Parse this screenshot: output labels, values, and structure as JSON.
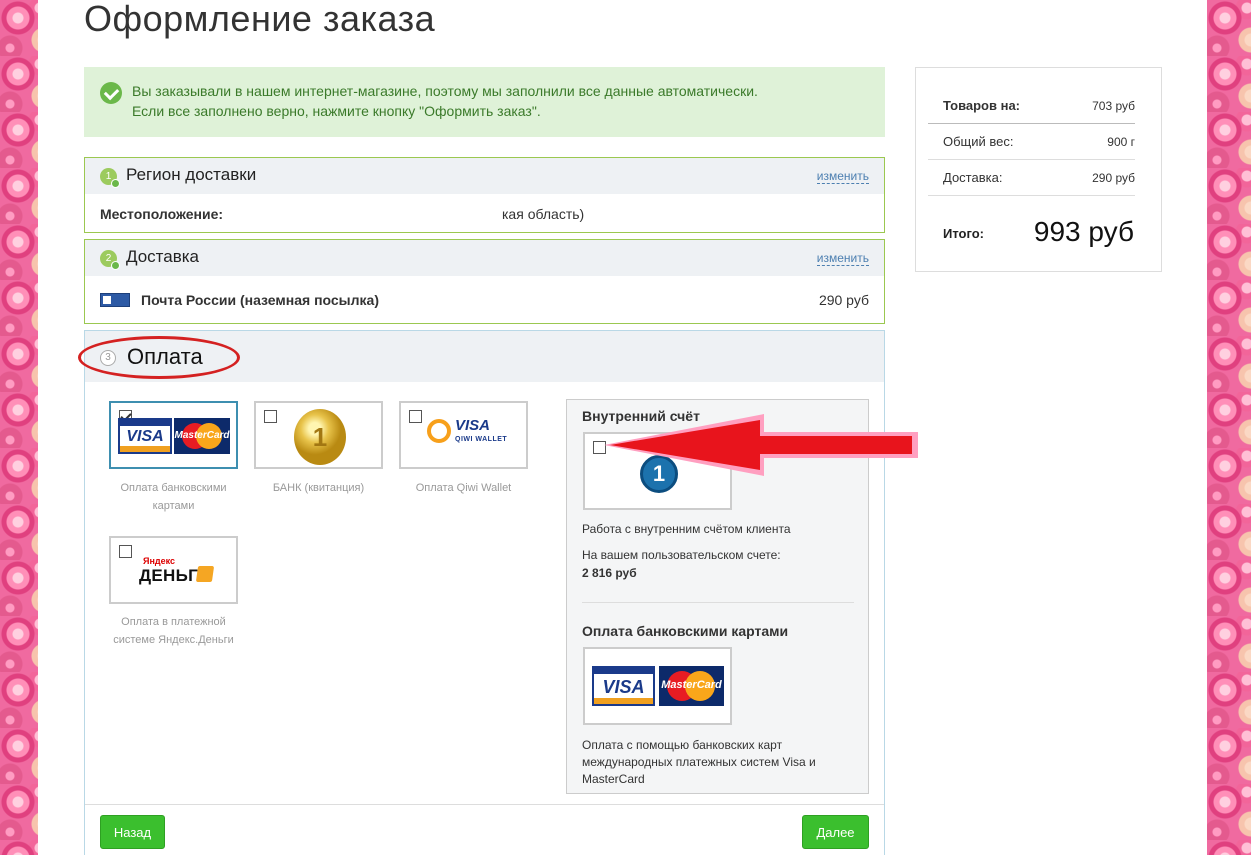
{
  "page": {
    "title": "Оформление заказа"
  },
  "notice": {
    "line1": "Вы заказывали в нашем интернет-магазине, поэтому мы заполнили все данные автоматически.",
    "line2": "Если все заполнено верно, нажмите кнопку \"Оформить заказ\"."
  },
  "region": {
    "step": "1",
    "title": "Регион доставки",
    "change": "изменить",
    "location_label": "Местоположение:",
    "location_value": "кая область)"
  },
  "delivery": {
    "step": "2",
    "title": "Доставка",
    "change": "изменить",
    "method": "Почта России (наземная посылка)",
    "price": "290 руб"
  },
  "payment": {
    "step": "3",
    "title": "Оплата",
    "options": [
      {
        "label": "Оплата банковскими картами",
        "checked": true
      },
      {
        "label": "БАНК (квитанция)",
        "checked": false
      },
      {
        "label": "Оплата Qiwi Wallet",
        "checked": false
      },
      {
        "label": "Оплата в платежной системе Яндекс.Деньги",
        "checked": false
      }
    ],
    "logos": {
      "visa": "VISA",
      "mastercard": "MasterCard",
      "coin": "1",
      "qiwi": "VISA",
      "qiwi_sub": "QIWI WALLET",
      "yandex_small": "Яндекс",
      "yandex_big": "ДЕНЬГИ"
    }
  },
  "inner_account": {
    "title": "Внутренний счёт",
    "icon_text": "1",
    "description": "Работа с внутренним счётом клиента",
    "balance_label": "На вашем пользовательском счете:",
    "balance_value": "2 816 руб"
  },
  "bank_cards": {
    "title": "Оплата банковскими картами",
    "description_line1": "Оплата с помощью банковских карт",
    "description_line2": "международных платежных систем Visa и",
    "description_line3": "MasterCard"
  },
  "buttons": {
    "back": "Назад",
    "next": "Далее"
  },
  "summary": {
    "goods_label": "Товаров на:",
    "goods_value": "703 руб",
    "weight_label": "Общий вес:",
    "weight_value": "900 г",
    "delivery_label": "Доставка:",
    "delivery_value": "290 руб",
    "total_label": "Итого:",
    "total_value": "993 руб"
  },
  "colors": {
    "accent_green": "#3bbf2e",
    "section_border": "#9bc850",
    "annotation_red": "#d42121",
    "arrow_red": "#e8141c",
    "notice_bg": "#dff2d8"
  }
}
